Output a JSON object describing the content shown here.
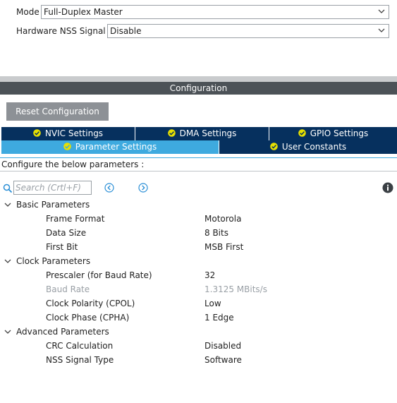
{
  "mode": {
    "mode_label": "Mode",
    "mode_value": "Full-Duplex Master",
    "nss_label": "Hardware NSS Signal",
    "nss_value": "Disable"
  },
  "configuration": {
    "title": "Configuration",
    "reset_label": "Reset Configuration",
    "tabs": [
      {
        "label": "NVIC Settings",
        "active": false
      },
      {
        "label": "DMA Settings",
        "active": false
      },
      {
        "label": "GPIO Settings",
        "active": false
      },
      {
        "label": "Parameter Settings",
        "active": true
      },
      {
        "label": "User Constants",
        "active": false
      }
    ],
    "instruction": "Configure the below parameters :",
    "search_placeholder": "Search (Crtl+F)"
  },
  "parameters": {
    "basic": {
      "label": "Basic Parameters",
      "items": [
        {
          "name": "Frame Format",
          "value": "Motorola"
        },
        {
          "name": "Data Size",
          "value": "8 Bits"
        },
        {
          "name": "First Bit",
          "value": "MSB First"
        }
      ]
    },
    "clock": {
      "label": "Clock Parameters",
      "items": [
        {
          "name": "Prescaler (for Baud Rate)",
          "value": "32"
        },
        {
          "name": "Baud Rate",
          "value": "1.3125 MBits/s",
          "disabled": true
        },
        {
          "name": "Clock Polarity (CPOL)",
          "value": "Low"
        },
        {
          "name": "Clock Phase (CPHA)",
          "value": "1 Edge"
        }
      ]
    },
    "advanced": {
      "label": "Advanced Parameters",
      "items": [
        {
          "name": "CRC Calculation",
          "value": "Disabled"
        },
        {
          "name": "NSS Signal Type",
          "value": "Software"
        }
      ]
    }
  },
  "colors": {
    "tab_dark": "#06305e",
    "tab_active": "#3eaadf",
    "title_bar": "#4c5257",
    "button_gray": "#8d9196",
    "ok_icon": "#e8e000"
  }
}
